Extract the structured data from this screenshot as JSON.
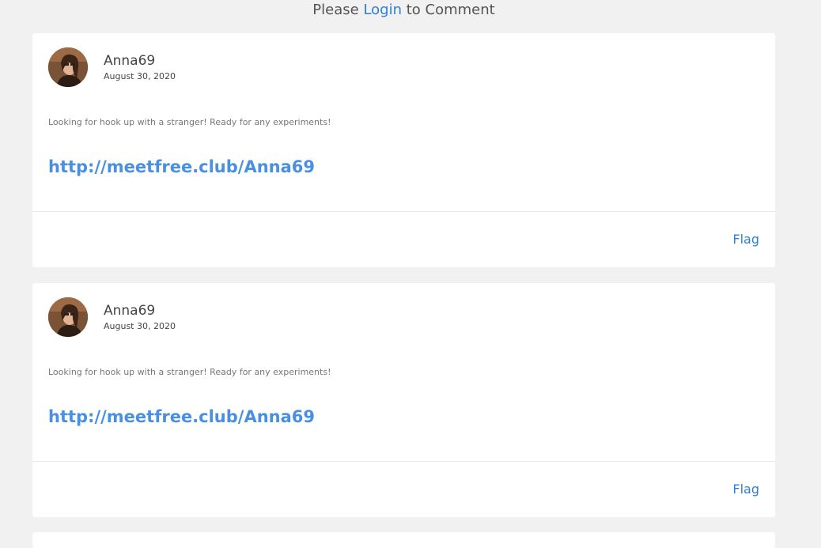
{
  "header": {
    "prefix": "Please",
    "login_label": "Login",
    "suffix": "to Comment"
  },
  "comments": [
    {
      "author": "Anna69",
      "date": "August 30, 2020",
      "message": "Looking for hook up with a stranger! Ready for any experiments!",
      "link": "http://meetfree.club/Anna69",
      "flag_label": "Flag"
    },
    {
      "author": "Anna69",
      "date": "August 30, 2020",
      "message": "Looking for hook up with a stranger! Ready for any experiments!",
      "link": "http://meetfree.club/Anna69",
      "flag_label": "Flag"
    }
  ],
  "colors": {
    "link": "#4a90e2",
    "accent": "#2f7fd1",
    "background": "#f1f1f1"
  }
}
